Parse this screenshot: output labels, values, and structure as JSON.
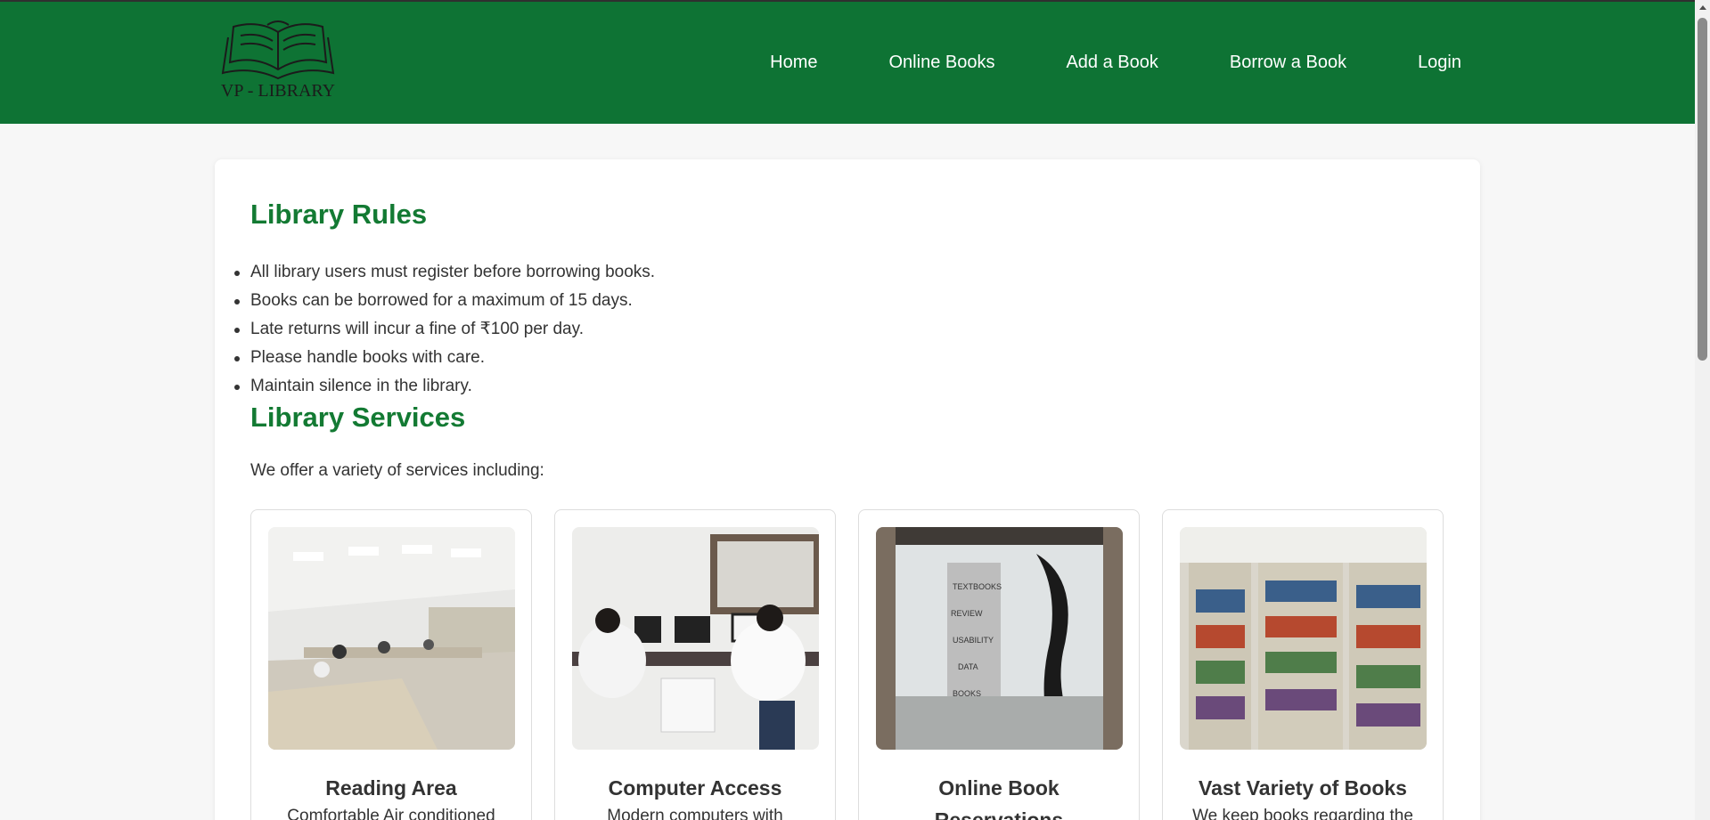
{
  "header": {
    "logo_text": "VP - LIBRARY",
    "nav": [
      "Home",
      "Online Books",
      "Add a Book",
      "Borrow a Book",
      "Login"
    ]
  },
  "rules": {
    "title": "Library Rules",
    "items": [
      "All library users must register before borrowing books.",
      "Books can be borrowed for a maximum of 15 days.",
      "Late returns will incur a fine of ₹100 per day.",
      "Please handle books with care.",
      "Maintain silence in the library."
    ]
  },
  "services": {
    "title": "Library Services",
    "intro": "We offer a variety of services including:",
    "cards": [
      {
        "title": "Reading Area",
        "desc": "Comfortable Air conditioned",
        "image": "reading-room-photo"
      },
      {
        "title": "Computer Access",
        "desc": "Modern computers with",
        "image": "computer-lab-photo"
      },
      {
        "title": "Online Book Reservations",
        "desc": "",
        "image": "glass-door-photo"
      },
      {
        "title": "Vast Variety of Books",
        "desc": "We keep books regarding the",
        "image": "bookshelves-photo"
      }
    ]
  },
  "colors": {
    "header_bg": "#0e7334",
    "heading": "#137a33",
    "page_bg": "#f7f7f7"
  }
}
